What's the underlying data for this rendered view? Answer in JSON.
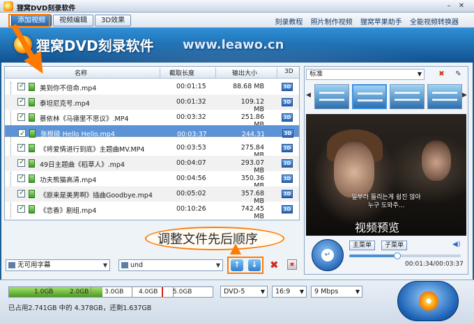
{
  "app": {
    "title": "狸窝DVD刻录软件"
  },
  "toolbar": {
    "tabs": [
      "添加视频",
      "视频编辑",
      "3D效果"
    ],
    "links": [
      "刻录教程",
      "照片制作视频",
      "狸窝苹果助手",
      "全能视频转换器"
    ]
  },
  "banner": {
    "title": "狸窝DVD刻录软件",
    "url": "www.leawo.cn"
  },
  "table": {
    "headers": {
      "name": "名称",
      "duration": "截取长度",
      "output": "输出大小",
      "d3": "3D"
    },
    "rows": [
      {
        "name": "美到你不倍命.mp4",
        "duration": "00:01:15",
        "size": "88.68 MB"
      },
      {
        "name": "泰坦尼克号.mp4",
        "duration": "00:01:32",
        "size": "109.12 MB"
      },
      {
        "name": "蔡依林《马德里不思议》.MP4",
        "duration": "00:03:32",
        "size": "251.86 MB"
      },
      {
        "name": "张根硕 Hello Hello.mp4",
        "duration": "00:03:37",
        "size": "244.31 MB"
      },
      {
        "name": "《将爱情进行到底》主题曲MV.MP4",
        "duration": "00:03:53",
        "size": "275.84 MB"
      },
      {
        "name": "49日主题曲《稻草人》.mp4",
        "duration": "00:04:07",
        "size": "293.07 MB"
      },
      {
        "name": "功夫熊猫高清.mp4",
        "duration": "00:04:56",
        "size": "350.36 MB"
      },
      {
        "name": "《原来是美男啊》插曲Goodbye.mp4",
        "duration": "00:05:02",
        "size": "357.68 MB"
      },
      {
        "name": "《恋香》剧组.mp4",
        "duration": "00:10:26",
        "size": "742.45 MB"
      }
    ],
    "selected_index": 3,
    "d3_label": "3D"
  },
  "controls": {
    "subtitle": "无可用字幕",
    "audio": "und"
  },
  "callouts": {
    "reorder": "调整文件先后顺序",
    "preview": "视频预览"
  },
  "preview": {
    "menu_style": "标准",
    "subtitle_line1": "일부러 들리는게 쉽진 않아",
    "subtitle_line2": "누구 도와주...",
    "main_menu": "主菜单",
    "sub_menu": "子菜单",
    "time": "00:01:34/00:03:37",
    "progress": 0.43
  },
  "capacity": {
    "labels": [
      "1.0GB",
      "2.0GB",
      "3.0GB",
      "4.0GB",
      "5.0GB"
    ],
    "used_fraction": 0.46,
    "status": "已占用2.741GB 中的 4.378GB，还剩1.637GB"
  },
  "output": {
    "disc": "DVD-5",
    "aspect": "16:9",
    "bitrate": "9 Mbps"
  },
  "colors": {
    "accent": "#ff7a00",
    "selected_row": "#5b93d6",
    "brand_blue": "#1b5e94"
  }
}
